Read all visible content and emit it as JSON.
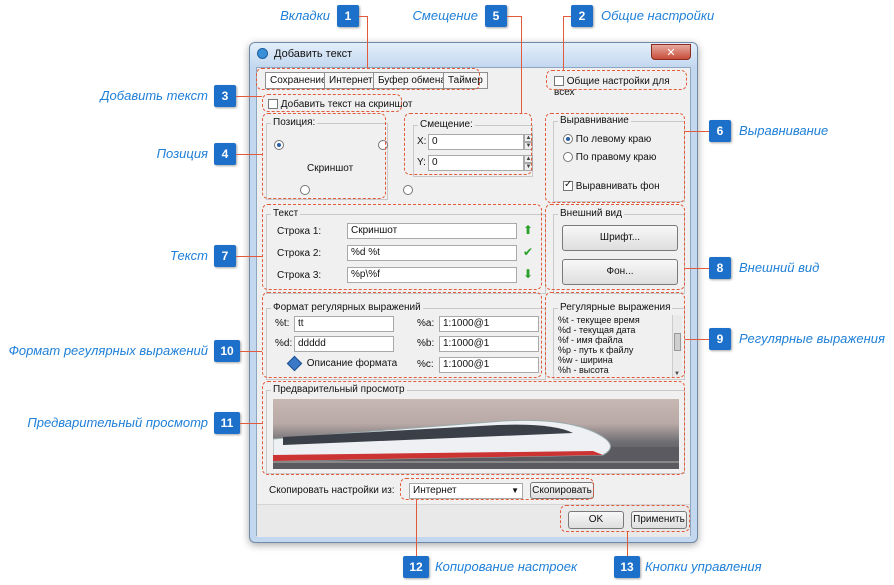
{
  "callouts": [
    {
      "n": "1",
      "label": "Вкладки"
    },
    {
      "n": "2",
      "label": "Общие настройки"
    },
    {
      "n": "3",
      "label": "Добавить текст"
    },
    {
      "n": "4",
      "label": "Позиция"
    },
    {
      "n": "5",
      "label": "Смещение"
    },
    {
      "n": "6",
      "label": "Выравнивание"
    },
    {
      "n": "7",
      "label": "Текст"
    },
    {
      "n": "8",
      "label": "Внешний вид"
    },
    {
      "n": "9",
      "label": "Регулярные выражения"
    },
    {
      "n": "10",
      "label": "Формат регулярных выражений"
    },
    {
      "n": "11",
      "label": "Предварительный просмотр"
    },
    {
      "n": "12",
      "label": "Копирование настроек"
    },
    {
      "n": "13",
      "label": "Кнопки управления"
    }
  ],
  "window": {
    "title": "Добавить текст",
    "close": "✕"
  },
  "tabs": [
    "Сохранение",
    "Интернет",
    "Буфер обмена",
    "Таймер"
  ],
  "general": {
    "label": "Общие настройки для всех",
    "checked": false
  },
  "add_text": {
    "label": "Добавить текст на скриншот",
    "checked": false
  },
  "position": {
    "title": "Позиция:",
    "center": "Скриншот"
  },
  "offset": {
    "title": "Смещение:",
    "x_label": "X:",
    "x_value": "0",
    "y_label": "Y:",
    "y_value": "0"
  },
  "align": {
    "title": "Выравнивание",
    "left": "По левому краю",
    "right": "По правому краю",
    "bg": "Выравнивать фон"
  },
  "text": {
    "title": "Текст",
    "rows": [
      {
        "label": "Строка 1:",
        "value": "Скриншот"
      },
      {
        "label": "Строка 2:",
        "value": "%d %t"
      },
      {
        "label": "Строка 3:",
        "value": "%p\\%f"
      }
    ]
  },
  "appearance": {
    "title": "Внешний вид",
    "font_btn": "Шрифт...",
    "bg_btn": "Фон..."
  },
  "regex_format": {
    "title": "Формат регулярных выражений",
    "t_label": "%t:",
    "t_value": "tt",
    "d_label": "%d:",
    "d_value": "ddddd",
    "desc": "Описание формата",
    "a_label": "%a:",
    "a_value": "1:1000@1",
    "b_label": "%b:",
    "b_value": "1:1000@1",
    "c_label": "%c:",
    "c_value": "1:1000@1"
  },
  "regex": {
    "title": "Регулярные выражения",
    "items": [
      "%t - текущее время",
      "%d - текущая дата",
      "%f - имя файла",
      "%p - путь к файлу",
      "%w - ширина",
      "%h - высота"
    ]
  },
  "preview": {
    "title": "Предварительный просмотр"
  },
  "copy": {
    "label": "Скопировать настройки из:",
    "value": "Интернет",
    "btn": "Скопировать"
  },
  "footer": {
    "ok": "OK",
    "apply": "Применить"
  }
}
